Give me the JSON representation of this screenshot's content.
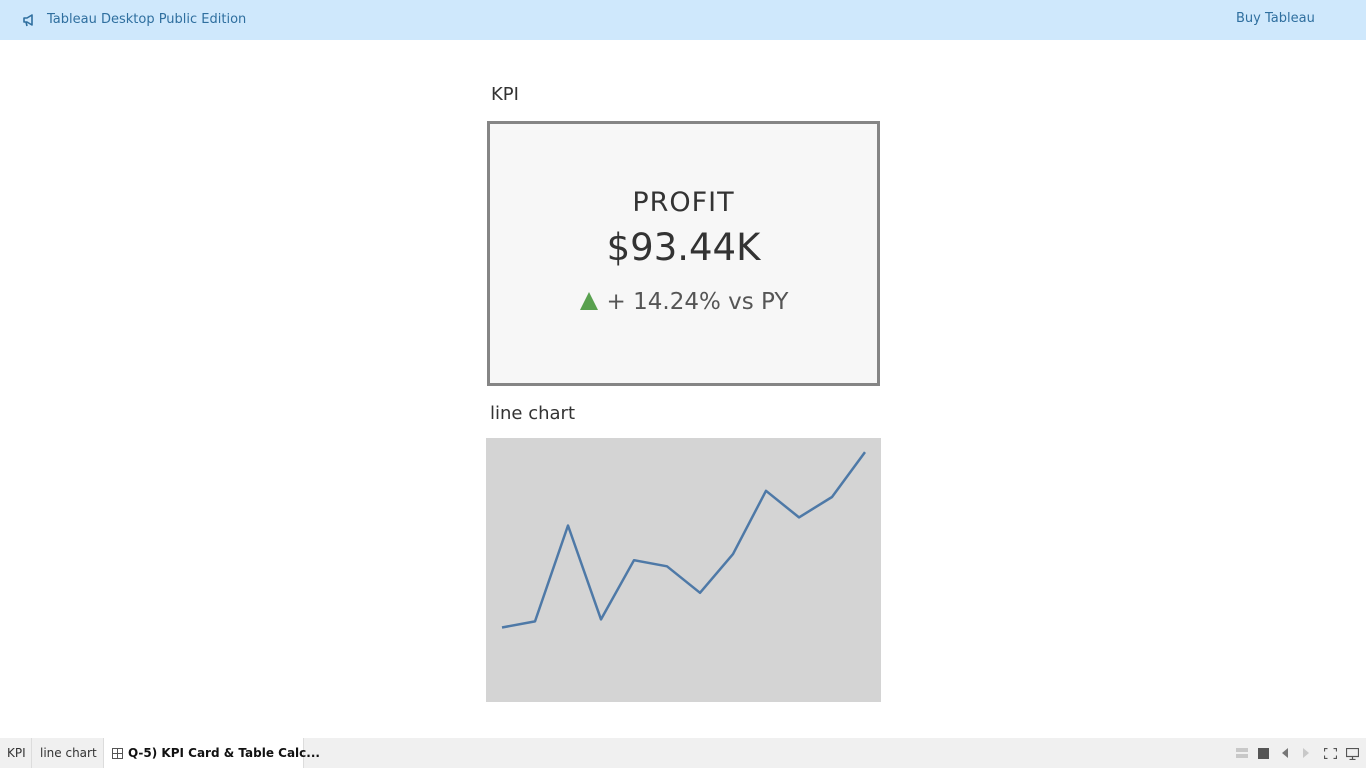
{
  "banner": {
    "app_title": "Tableau Desktop Public Edition",
    "buy_label": "Buy Tableau",
    "icon": "megaphone-icon"
  },
  "kpi": {
    "heading": "KPI",
    "metric": "PROFIT",
    "value": "$93.44K",
    "change_text": "+ 14.24% vs PY",
    "trend_icon": "up-triangle-icon",
    "trend_color": "#59a14f"
  },
  "line_chart": {
    "heading": "line chart"
  },
  "chart_data": {
    "type": "line",
    "title": "line chart",
    "x": [
      1,
      2,
      3,
      4,
      5,
      6,
      7,
      8,
      9,
      10,
      11,
      12
    ],
    "series": [
      {
        "values": [
          0.12,
          0.15,
          0.62,
          0.16,
          0.45,
          0.42,
          0.29,
          0.48,
          0.79,
          0.66,
          0.76,
          0.98
        ]
      }
    ],
    "ylim": [
      0,
      1
    ],
    "line_color": "#4e79a7",
    "background": "#d4d4d4",
    "grid": false,
    "axes_visible": false
  },
  "tabs": [
    {
      "label": "KPI",
      "active": false
    },
    {
      "label": "line chart",
      "active": false
    },
    {
      "label": "Q-5) KPI Card & Table Calc...",
      "active": true
    }
  ],
  "controls": [
    "show-sheets-icon",
    "filmstrip-icon",
    "previous-sheet-icon",
    "next-sheet-icon",
    "fullscreen-icon",
    "presentation-mode-icon"
  ]
}
